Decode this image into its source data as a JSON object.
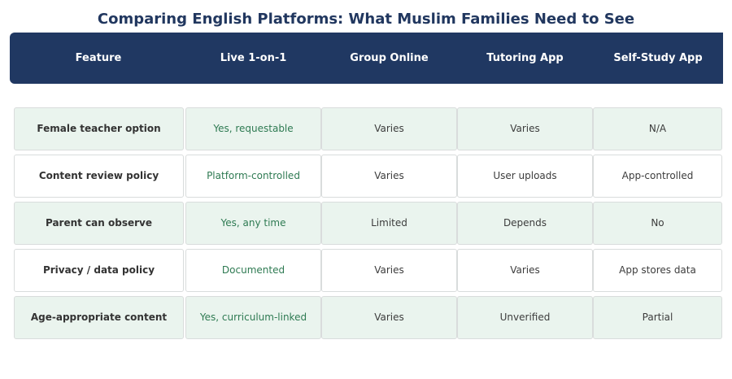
{
  "title": "Comparing English Platforms: What Muslim Families Need to See",
  "colors": {
    "header_bg": "#203862",
    "title": "#21375f",
    "shaded_row": "#eaf4ee",
    "live_text": "#2e7a52"
  },
  "columns": [
    "Feature",
    "Live 1-on-1",
    "Group Online",
    "Tutoring App",
    "Self-Study App"
  ],
  "rows": [
    {
      "feature": "Female teacher option",
      "live": "Yes, requestable",
      "group": "Varies",
      "tutoring": "Varies",
      "selfstudy": "N/A"
    },
    {
      "feature": "Content review policy",
      "live": "Platform-controlled",
      "group": "Varies",
      "tutoring": "User uploads",
      "selfstudy": "App-controlled"
    },
    {
      "feature": "Parent can observe",
      "live": "Yes, any time",
      "group": "Limited",
      "tutoring": "Depends",
      "selfstudy": "No"
    },
    {
      "feature": "Privacy / data policy",
      "live": "Documented",
      "group": "Varies",
      "tutoring": "Varies",
      "selfstudy": "App stores data"
    },
    {
      "feature": "Age-appropriate content",
      "live": "Yes, curriculum-linked",
      "group": "Varies",
      "tutoring": "Unverified",
      "selfstudy": "Partial"
    }
  ]
}
